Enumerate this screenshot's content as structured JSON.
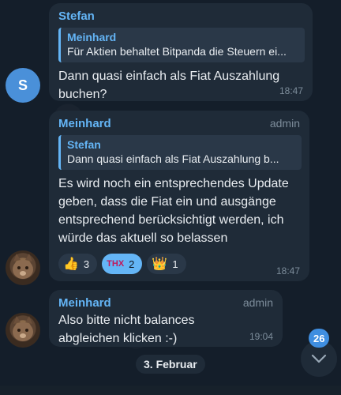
{
  "messages": [
    {
      "sender": "Stefan",
      "avatar_letter": "S",
      "reply": {
        "name": "Meinhard",
        "text": "Für Aktien behaltet Bitpanda die Steuern ei..."
      },
      "text": "Dann quasi einfach als Fiat Auszahlung buchen?",
      "time": "18:47"
    },
    {
      "sender": "Meinhard",
      "role": "admin",
      "reply": {
        "name": "Stefan",
        "text": "Dann quasi einfach als Fiat Auszahlung b..."
      },
      "text": "Es wird noch ein entsprechendes Update geben, dass die Fiat ein und ausgänge entsprechend berücksichtigt werden, ich würde das aktuell so belassen",
      "reactions": [
        {
          "emoji": "👍",
          "count": "3",
          "active": false
        },
        {
          "emoji": "THX",
          "count": "2",
          "active": true
        },
        {
          "emoji": "👑",
          "count": "1",
          "active": false
        }
      ],
      "time": "18:47"
    },
    {
      "sender": "Meinhard",
      "role": "admin",
      "text": "Also bitte nicht balances abgleichen klicken :-)",
      "time": "19:04"
    }
  ],
  "date_separator": "3. Februar",
  "unread_count": "26",
  "colors": {
    "accent": "#64b5f6",
    "bubble": "#1f2b38",
    "background": "#141e2a"
  },
  "icons": {
    "scroll_down": "chevron-down-icon"
  }
}
